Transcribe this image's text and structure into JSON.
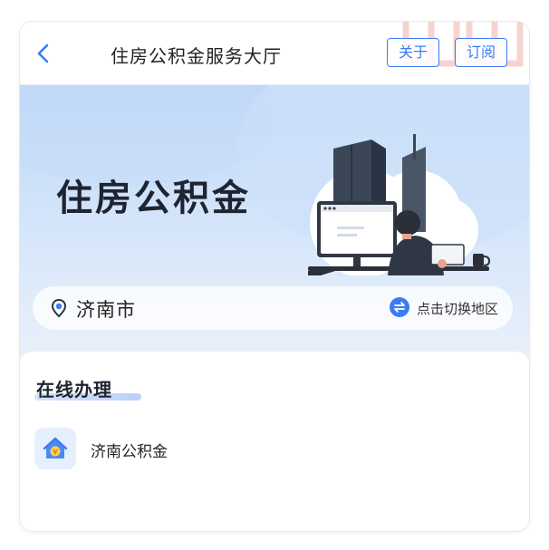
{
  "header": {
    "title": "住房公积金服务大厅",
    "about_label": "关于",
    "subscribe_label": "订阅"
  },
  "hero": {
    "title": "住房公积金"
  },
  "location": {
    "city": "济南市",
    "switch_label": "点击切换地区"
  },
  "online": {
    "section_title": "在线办理",
    "items": [
      {
        "label": "济南公积金",
        "icon": "house-coin-icon"
      }
    ]
  },
  "colors": {
    "accent": "#3b7cf3",
    "hero_top": "#bcd7f8",
    "hero_bottom": "#e9f0fa",
    "dark_text": "#1e2430"
  }
}
